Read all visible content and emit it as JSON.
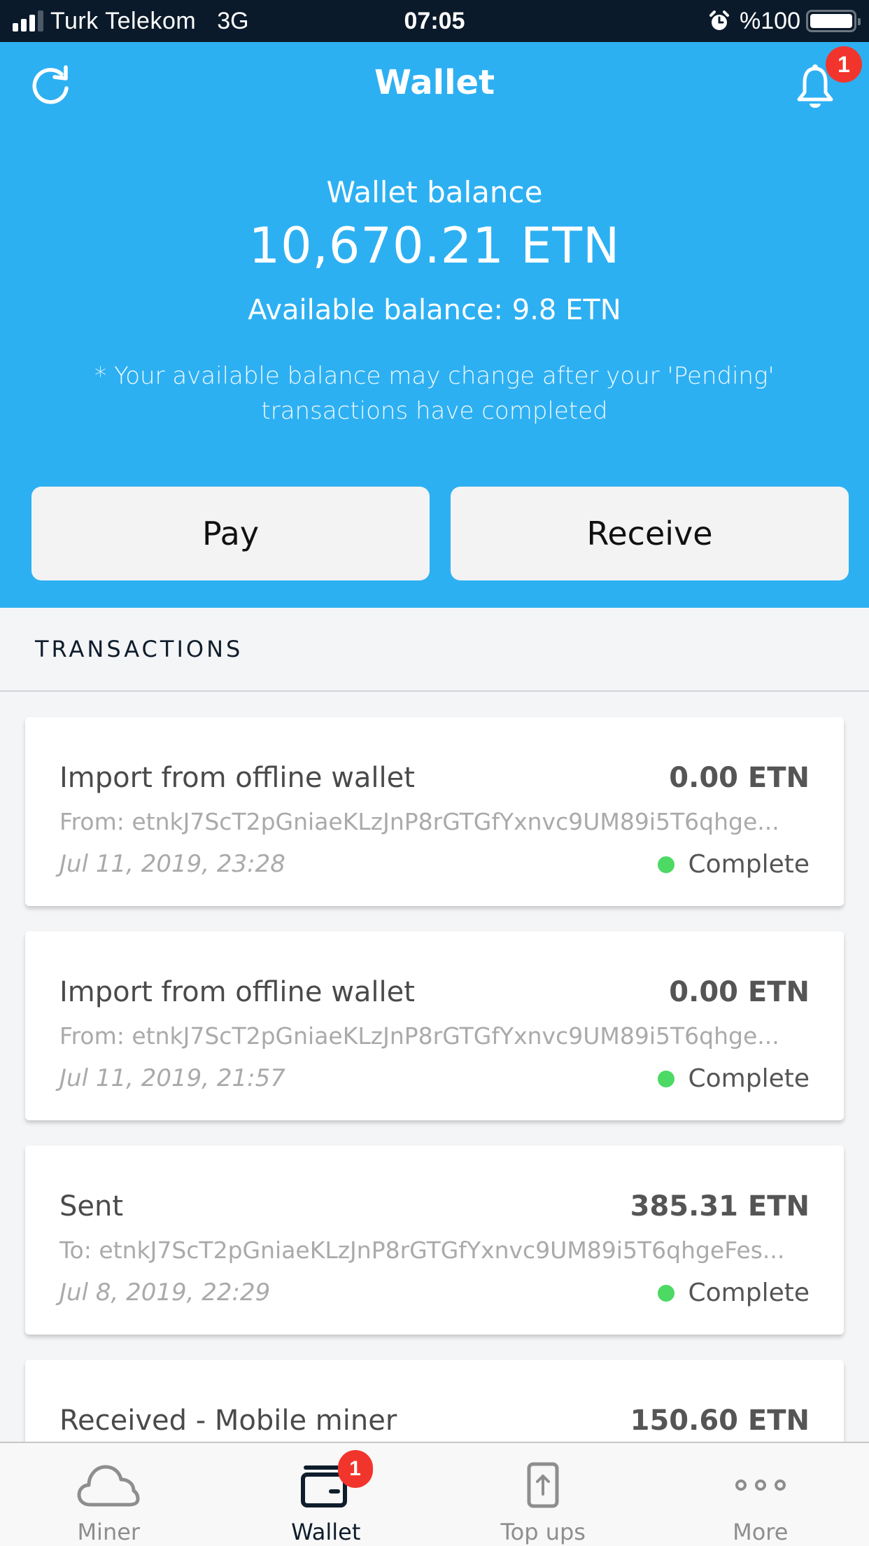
{
  "status_bar": {
    "carrier": "Turk Telekom",
    "network": "3G",
    "time": "07:05",
    "battery_text": "%100",
    "signal_bars_active": 3,
    "signal_bars_total": 4,
    "battery_level": 1.0
  },
  "header": {
    "title": "Wallet",
    "notification_count": "1",
    "refresh_icon": "refresh-icon",
    "bell_icon": "bell-icon"
  },
  "balance": {
    "label": "Wallet balance",
    "amount": "10,670.21 ETN",
    "available": "Available balance: 9.8 ETN",
    "note": "* Your available balance may change after your 'Pending' transactions have completed"
  },
  "actions": {
    "pay_label": "Pay",
    "receive_label": "Receive"
  },
  "transactions": {
    "header": "TRANSACTIONS",
    "items": [
      {
        "title": "Import from offline wallet",
        "amount": "0.00 ETN",
        "address": "From: etnkJ7ScT2pGniaeKLzJnP8rGTGfYxnvc9UM89i5T6qhge...",
        "date": "Jul 11, 2019, 23:28",
        "status": "Complete"
      },
      {
        "title": "Import from offline wallet",
        "amount": "0.00 ETN",
        "address": "From: etnkJ7ScT2pGniaeKLzJnP8rGTGfYxnvc9UM89i5T6qhge...",
        "date": "Jul 11, 2019, 21:57",
        "status": "Complete"
      },
      {
        "title": "Sent",
        "amount": "385.31 ETN",
        "address": "To: etnkJ7ScT2pGniaeKLzJnP8rGTGfYxnvc9UM89i5T6qhgeFes...",
        "date": "Jul 8, 2019, 22:29",
        "status": "Complete"
      },
      {
        "title": "Received - Mobile miner",
        "amount": "150.60 ETN",
        "address": "",
        "date": "",
        "status": ""
      }
    ]
  },
  "tab_bar": {
    "tabs": [
      {
        "label": "Miner",
        "icon": "cloud-icon",
        "active": false
      },
      {
        "label": "Wallet",
        "icon": "wallet-icon",
        "active": true,
        "badge": "1"
      },
      {
        "label": "Top ups",
        "icon": "phone-upload-icon",
        "active": false
      },
      {
        "label": "More",
        "icon": "more-dots-icon",
        "active": false
      }
    ]
  },
  "colors": {
    "brand_blue": "#2db0f2",
    "status_bar_bg": "#0b1a2a",
    "badge_red": "#f2352c",
    "complete_green": "#4cd964",
    "active_tab": "#0f1d2c",
    "inactive_tab": "#8e8e8e"
  }
}
